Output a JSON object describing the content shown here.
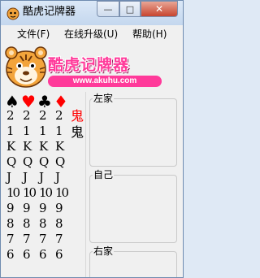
{
  "window": {
    "title": "酷虎记牌器"
  },
  "titlebar_buttons": {
    "minimize": "—",
    "maximize": "□",
    "close": "✕"
  },
  "menu": [
    {
      "label": "文件(F)"
    },
    {
      "label": "在线升级(U)"
    },
    {
      "label": "帮助(H)"
    }
  ],
  "banner": {
    "title": "酷虎记牌器",
    "url": "www.akuhu.com"
  },
  "cards": {
    "suits": [
      {
        "symbol": "♠",
        "color": "#000000"
      },
      {
        "symbol": "♥",
        "color": "#ff0000"
      },
      {
        "symbol": "♣",
        "color": "#000000"
      },
      {
        "symbol": "♦",
        "color": "#ff0000"
      }
    ],
    "ranks": [
      "2",
      "1",
      "K",
      "Q",
      "J",
      "10",
      "9",
      "8",
      "7",
      "6"
    ],
    "jokers": [
      {
        "label": "鬼",
        "color": "#ff0000"
      },
      {
        "label": "鬼",
        "color": "#000000"
      }
    ]
  },
  "panels": [
    {
      "label": "左家"
    },
    {
      "label": "自己"
    },
    {
      "label": "右家"
    }
  ]
}
